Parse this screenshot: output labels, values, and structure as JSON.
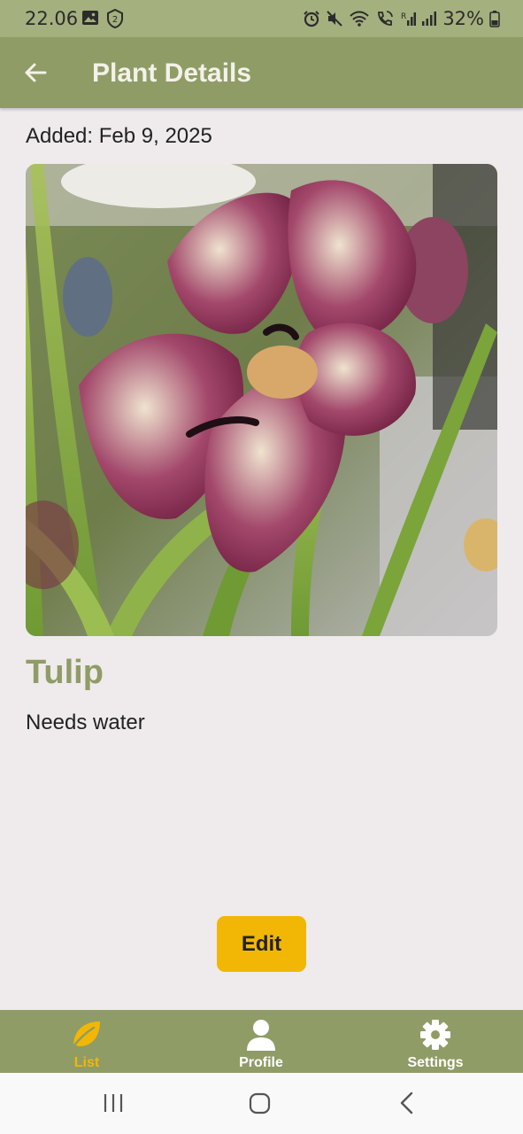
{
  "status_bar": {
    "time": "22.06",
    "battery": "32%"
  },
  "app_bar": {
    "title": "Plant Details",
    "back_icon": "arrow-left-icon"
  },
  "plant": {
    "added_date": "Added: Feb 9, 2025",
    "name": "Tulip",
    "status": "Needs water"
  },
  "actions": {
    "edit_label": "Edit"
  },
  "bottom_nav": {
    "items": [
      {
        "label": "List",
        "icon": "leaf-icon",
        "active": true
      },
      {
        "label": "Profile",
        "icon": "person-icon",
        "active": false
      },
      {
        "label": "Settings",
        "icon": "gear-icon",
        "active": false
      }
    ]
  },
  "colors": {
    "status_bar": "#a4b07e",
    "app_bar": "#8f9c66",
    "accent": "#f2b705",
    "background": "#efebec"
  }
}
